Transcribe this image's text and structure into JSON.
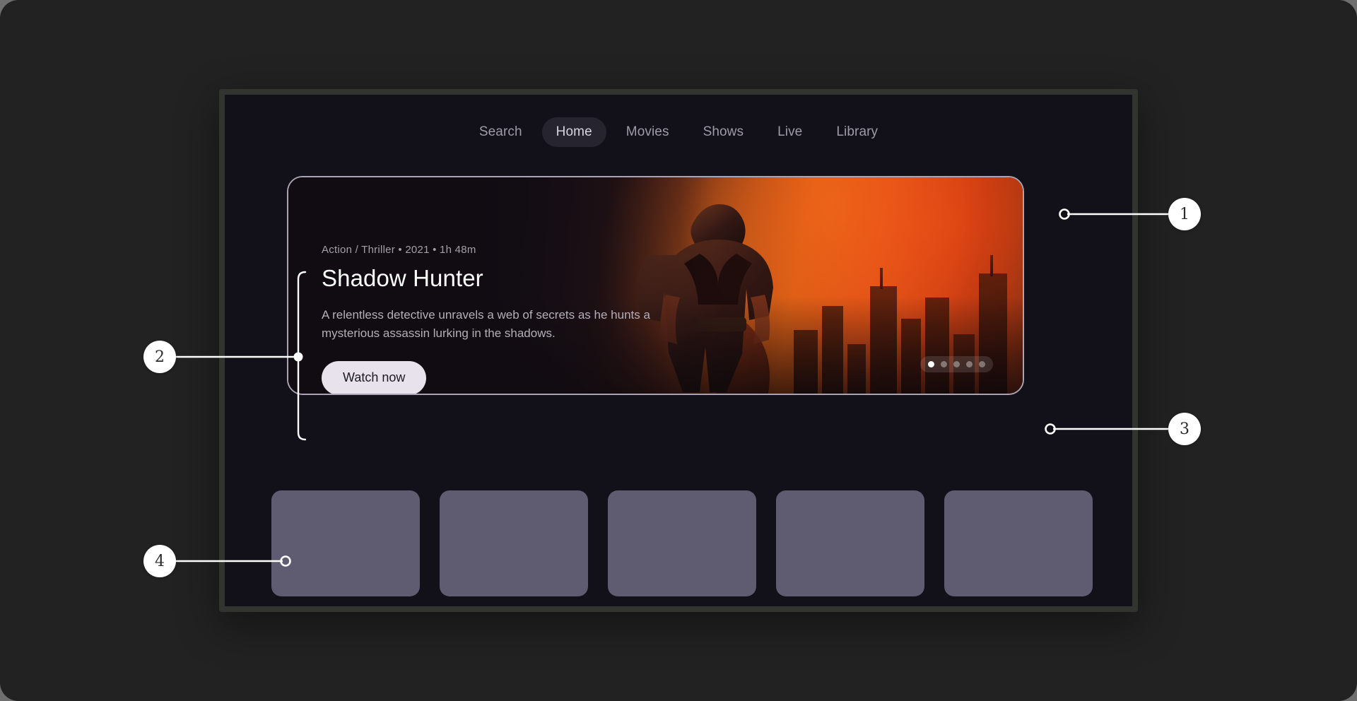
{
  "nav": {
    "items": [
      {
        "label": "Search",
        "active": false
      },
      {
        "label": "Home",
        "active": true
      },
      {
        "label": "Movies",
        "active": false
      },
      {
        "label": "Shows",
        "active": false
      },
      {
        "label": "Live",
        "active": false
      },
      {
        "label": "Library",
        "active": false
      }
    ]
  },
  "hero": {
    "meta": "Action / Thriller • 2021 • 1h 48m",
    "title": "Shadow Hunter",
    "description": "A relentless detective unravels a web of secrets as he hunts a mysterious assassin lurking in the shadows.",
    "watch_button": "Watch now",
    "pagination": {
      "total": 5,
      "active_index": 0
    }
  },
  "rail": {
    "cards": [
      {
        "id": "card-1"
      },
      {
        "id": "card-2"
      },
      {
        "id": "card-3"
      },
      {
        "id": "card-4"
      },
      {
        "id": "card-5"
      }
    ]
  },
  "annotations": {
    "callouts": [
      {
        "number": "1",
        "target": "hero-banner-edge"
      },
      {
        "number": "2",
        "target": "hero-text-block"
      },
      {
        "number": "3",
        "target": "carousel-pagination-dots"
      },
      {
        "number": "4",
        "target": "content-card-rail"
      }
    ]
  },
  "colors": {
    "page_background": "#222222",
    "device_frame": "#32352f",
    "screen_background": "#121019",
    "hero_border": "#a9a3b4",
    "accent_button": "#e8e2ec",
    "card_fill": "#5f5b70",
    "nav_active_pill": "#26242f",
    "callout_badge": "#ffffff"
  }
}
